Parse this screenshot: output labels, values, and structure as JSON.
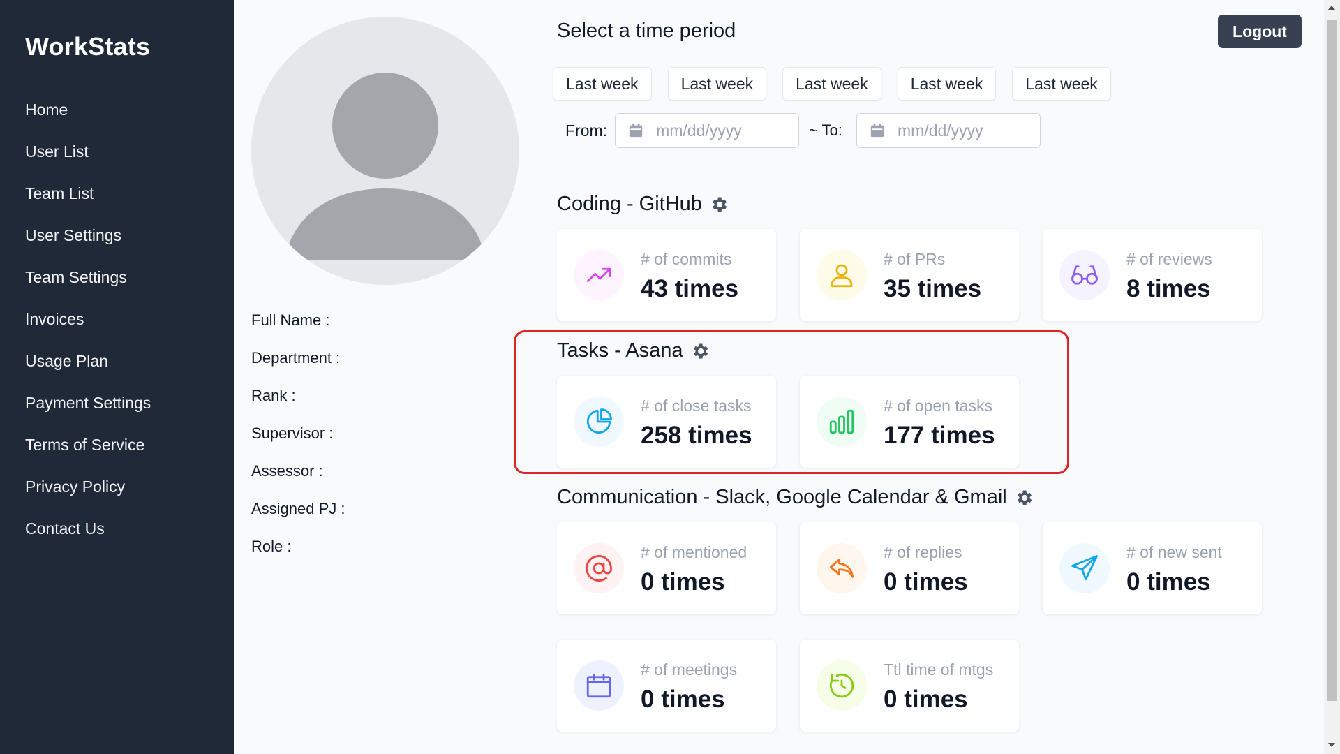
{
  "sidebar": {
    "brand": "WorkStats",
    "items": [
      {
        "label": "Home"
      },
      {
        "label": "User List"
      },
      {
        "label": "Team List"
      },
      {
        "label": "User Settings"
      },
      {
        "label": "Team Settings"
      },
      {
        "label": "Invoices"
      },
      {
        "label": "Usage Plan"
      },
      {
        "label": "Payment Settings"
      },
      {
        "label": "Terms of Service"
      },
      {
        "label": "Privacy Policy"
      },
      {
        "label": "Contact Us"
      }
    ]
  },
  "profile": {
    "fields": [
      {
        "label": "Full Name :"
      },
      {
        "label": "Department :"
      },
      {
        "label": "Rank :"
      },
      {
        "label": "Supervisor :"
      },
      {
        "label": "Assessor :"
      },
      {
        "label": "Assigned PJ :"
      },
      {
        "label": "Role :"
      }
    ]
  },
  "period": {
    "title": "Select a time period",
    "buttons": [
      "Last week",
      "Last week",
      "Last week",
      "Last week",
      "Last week"
    ],
    "from_label": "From:",
    "from_placeholder": "mm/dd/yyyy",
    "to_label": "~ To:",
    "to_placeholder": "mm/dd/yyyy"
  },
  "header": {
    "logout_label": "Logout"
  },
  "sections": {
    "coding": {
      "title": "Coding - GitHub",
      "cards": [
        {
          "label": "# of commits",
          "value": "43 times",
          "icon": "trending-up-icon",
          "color": "#d946ef",
          "bg": "#fdf4ff"
        },
        {
          "label": "# of PRs",
          "value": "35 times",
          "icon": "user-icon",
          "color": "#eab308",
          "bg": "#fefce8"
        },
        {
          "label": "# of reviews",
          "value": "8 times",
          "icon": "glasses-icon",
          "color": "#8b5cf6",
          "bg": "#f5f3ff"
        }
      ]
    },
    "tasks": {
      "title": "Tasks - Asana",
      "cards": [
        {
          "label": "# of close tasks",
          "value": "258 times",
          "icon": "pie-chart-icon",
          "color": "#0ea5e9",
          "bg": "#f0f9ff"
        },
        {
          "label": "# of open tasks",
          "value": "177 times",
          "icon": "bar-chart-icon",
          "color": "#22c55e",
          "bg": "#f0fdf4"
        }
      ]
    },
    "communication": {
      "title": "Communication - Slack, Google Calendar & Gmail",
      "cards": [
        {
          "label": "# of mentioned",
          "value": "0 times",
          "icon": "at-sign-icon",
          "color": "#ef4444",
          "bg": "#fef2f2"
        },
        {
          "label": "# of replies",
          "value": "0 times",
          "icon": "reply-icon",
          "color": "#f97316",
          "bg": "#fff7ed"
        },
        {
          "label": "# of new sent",
          "value": "0 times",
          "icon": "send-icon",
          "color": "#0ea5e9",
          "bg": "#f0f9ff"
        },
        {
          "label": "# of meetings",
          "value": "0 times",
          "icon": "calendar-icon",
          "color": "#6366f1",
          "bg": "#eef2ff"
        },
        {
          "label": "Ttl time of mtgs",
          "value": "0 times",
          "icon": "clock-icon",
          "color": "#84cc16",
          "bg": "#f7fee7"
        }
      ]
    }
  }
}
